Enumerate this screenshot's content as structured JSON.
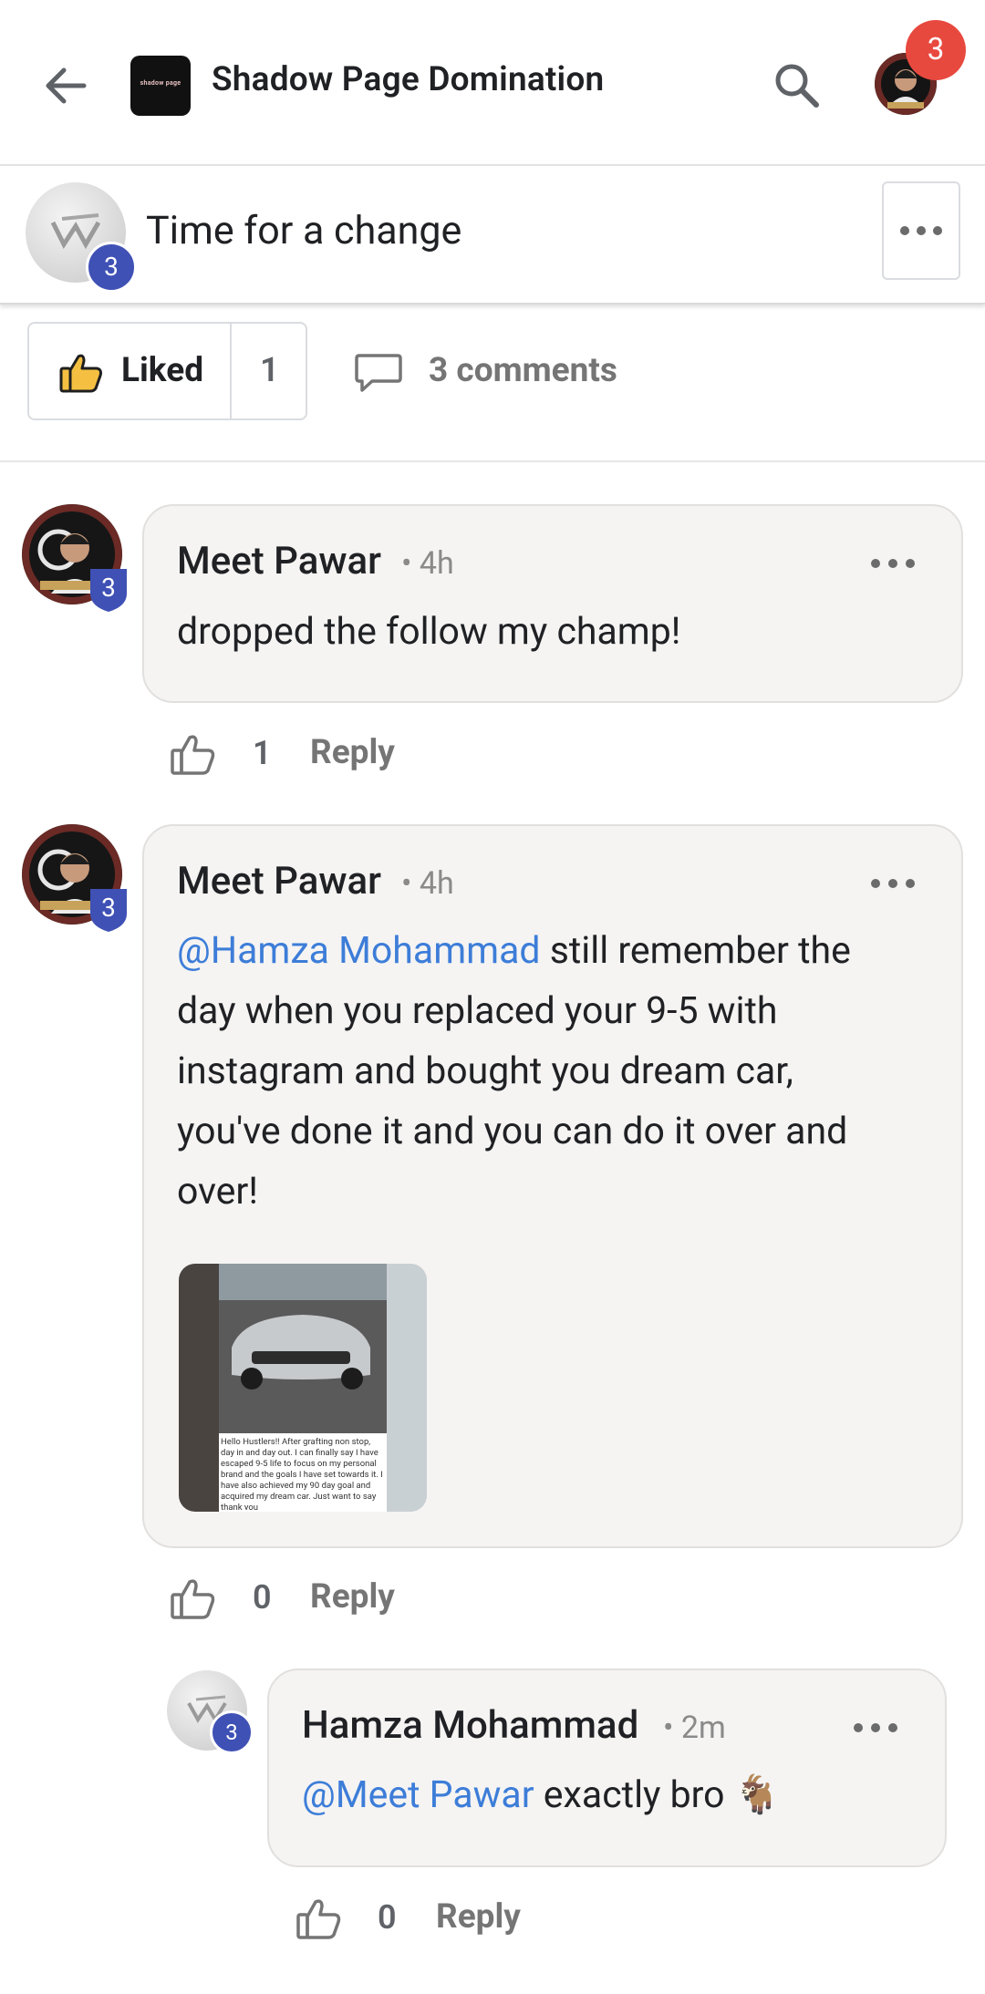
{
  "header": {
    "group_name": "Shadow Page Domination",
    "group_logo_text": "shadow page",
    "notification_count": "3"
  },
  "post": {
    "title": "Time for a change",
    "author_level": "3",
    "liked_label": "Liked",
    "like_count": "1",
    "comments_label": "3 comments"
  },
  "comments": [
    {
      "author": "Meet Pawar",
      "time": "• 4h",
      "level": "3",
      "text": "dropped the follow my champ!",
      "likes": "1",
      "reply_label": "Reply"
    },
    {
      "author": "Meet Pawar",
      "time": "• 4h",
      "level": "3",
      "mention": "@Hamza Mohammad",
      "text_lines": [
        " still remember the",
        "day when you replaced your 9-5 with",
        "instagram and bought you dream car,",
        "you've done it and you can do it over and",
        "over!"
      ],
      "image_caption": "Hello Hustlers!! After grafting non stop, day in and day out. I can finally say I have escaped 9-5 life to focus on my personal brand and the goals I have set towards it. I have also achieved my 90 day goal and acquired my dream car. Just want to say thank you",
      "likes": "0",
      "reply_label": "Reply"
    }
  ],
  "reply": {
    "author": "Hamza Mohammad",
    "time": "• 2m",
    "level": "3",
    "mention": "@Meet Pawar",
    "text": " exactly bro 🐐",
    "likes": "0",
    "reply_label": "Reply"
  },
  "colors": {
    "accent_level": "#3f51b5",
    "mention": "#3d7dd8",
    "notification": "#e8493f"
  },
  "icons": [
    "back-arrow-icon",
    "search-icon",
    "more-icon",
    "thumbs-up-filled-icon",
    "comment-icon",
    "thumbs-up-outline-icon",
    "level-shield-icon"
  ]
}
